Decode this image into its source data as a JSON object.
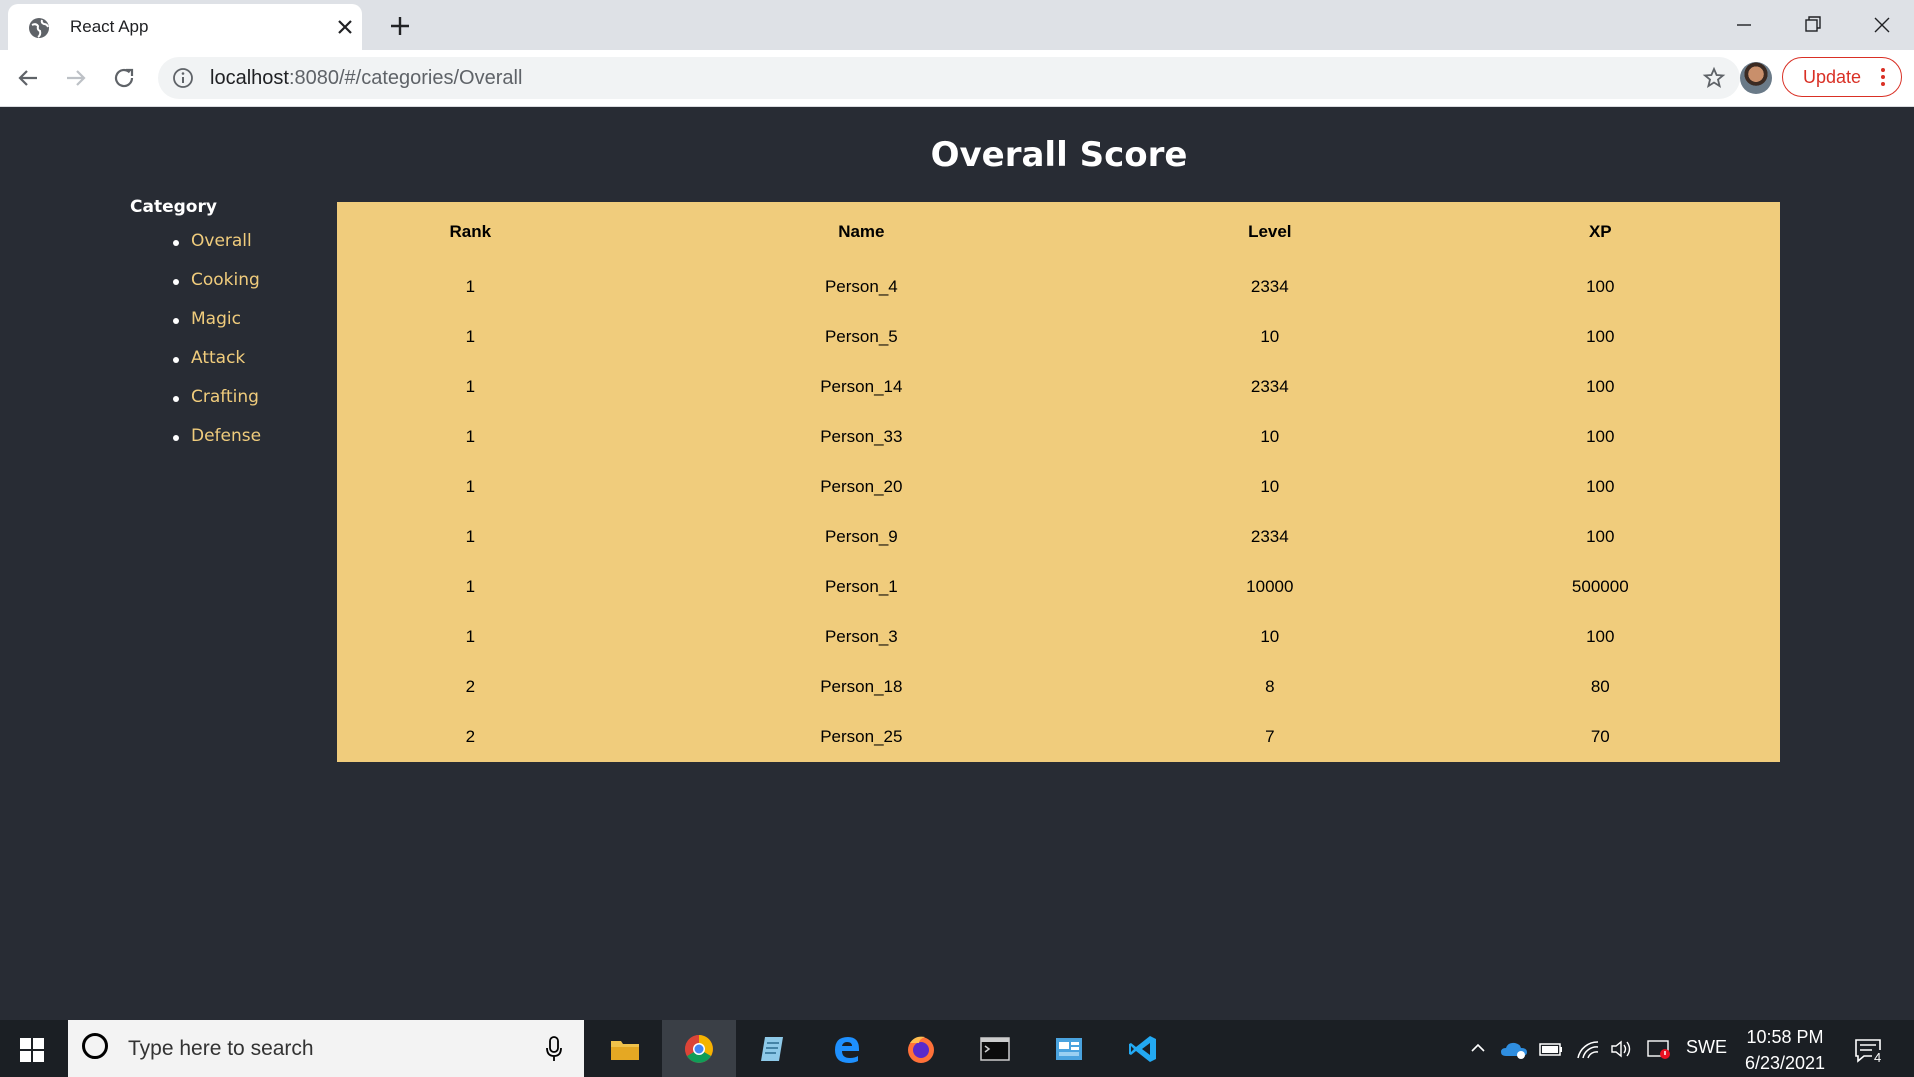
{
  "browser": {
    "tab_title": "React App",
    "url_host": "localhost",
    "url_rest": ":8080/#/categories/Overall",
    "update_label": "Update"
  },
  "page": {
    "title": "Overall Score"
  },
  "sidebar": {
    "heading": "Category",
    "items": [
      {
        "label": "Overall"
      },
      {
        "label": "Cooking"
      },
      {
        "label": "Magic"
      },
      {
        "label": "Attack"
      },
      {
        "label": "Crafting"
      },
      {
        "label": "Defense"
      }
    ]
  },
  "table": {
    "headers": [
      "Rank",
      "Name",
      "Level",
      "XP"
    ],
    "rows": [
      [
        "1",
        "Person_4",
        "2334",
        "100"
      ],
      [
        "1",
        "Person_5",
        "10",
        "100"
      ],
      [
        "1",
        "Person_14",
        "2334",
        "100"
      ],
      [
        "1",
        "Person_33",
        "10",
        "100"
      ],
      [
        "1",
        "Person_20",
        "10",
        "100"
      ],
      [
        "1",
        "Person_9",
        "2334",
        "100"
      ],
      [
        "1",
        "Person_1",
        "10000",
        "500000"
      ],
      [
        "1",
        "Person_3",
        "10",
        "100"
      ],
      [
        "2",
        "Person_18",
        "8",
        "80"
      ],
      [
        "2",
        "Person_25",
        "7",
        "70"
      ]
    ]
  },
  "taskbar": {
    "search_placeholder": "Type here to search",
    "language": "SWE",
    "time": "10:58 PM",
    "date": "6/23/2021",
    "notification_count": "4"
  },
  "colors": {
    "page_bg": "#282c34",
    "table_bg": "#f0cc7c",
    "link": "#f0cc7c",
    "update_red": "#d93025"
  }
}
